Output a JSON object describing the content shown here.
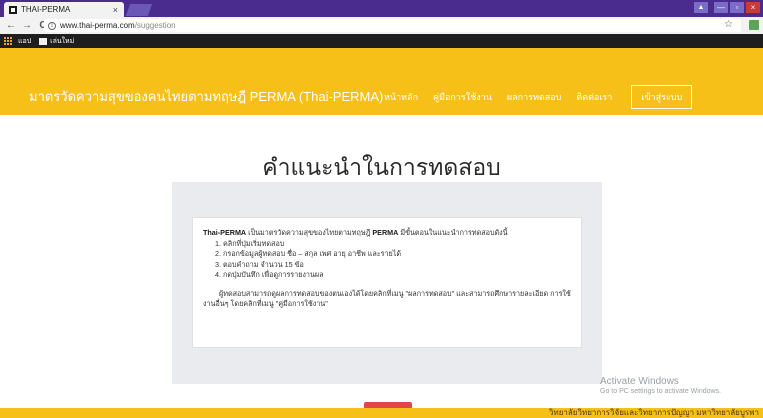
{
  "browser": {
    "tab_title": "THAI-PERMA",
    "tab_close": "×",
    "url_host": "www.thai-perma.com",
    "url_path": "/suggestion",
    "bookmarks": [
      "แอป",
      "เล่นใหม่"
    ],
    "win_min": "—",
    "win_max": "▫",
    "win_close": "×",
    "back": "←",
    "forward": "→",
    "reload": "C",
    "star": "☆"
  },
  "header": {
    "site_title": "มาตรวัดความสุขของคนไทยตามทฤษฎี PERMA (Thai-PERMA)",
    "nav": [
      "หน้าหลัก",
      "คู่มือการใช้งาน",
      "ผลการทดสอบ",
      "ติดต่อเรา"
    ],
    "login": "เข้าสู่ระบบ"
  },
  "main": {
    "heading": "คำแนะนำในการทดสอบ",
    "intro_brand": "Thai-PERMA",
    "intro_mid": " เป็นมาตรวัดความสุขของไทยตามทฤษฎี ",
    "intro_perma": "PERMA",
    "intro_end": " มีขั้นตอนในแนะนำการทดสอบดังนี้",
    "steps": [
      "1. คลิกที่ปุ่มเริ่มทดสอบ",
      "2. กรอกข้อมูลผู้ทดสอบ ชื่อ – สกุล เพศ อายุ อาชีพ และรายได้",
      "3. ตอบคำถาม จำนวน 15 ข้อ",
      "4. กดปุ่มบันทึก เพื่อดูการรายงานผล"
    ],
    "note": "ผู้ทดสอบสามารถดูผลการทดสอบของตนเองได้โดยคลิกที่เมนู \"ผลการทดสอบ\" และสามารถศึกษารายละเอียด การใช้งานอื่นๆ โดยคลิกที่เมนู \"คู่มือการใช้งาน\""
  },
  "watermark": {
    "title": "Activate Windows",
    "subtitle": "Go to PC settings to activate Windows."
  },
  "footer": {
    "text": "วิทยาลัยวิทยาการวิจัยและวิทยาการปัญญา มหาวิทยาลัยบูรพา"
  },
  "colors": {
    "brand_yellow": "#f7c018",
    "tabbar_purple": "#4a2c8f"
  }
}
